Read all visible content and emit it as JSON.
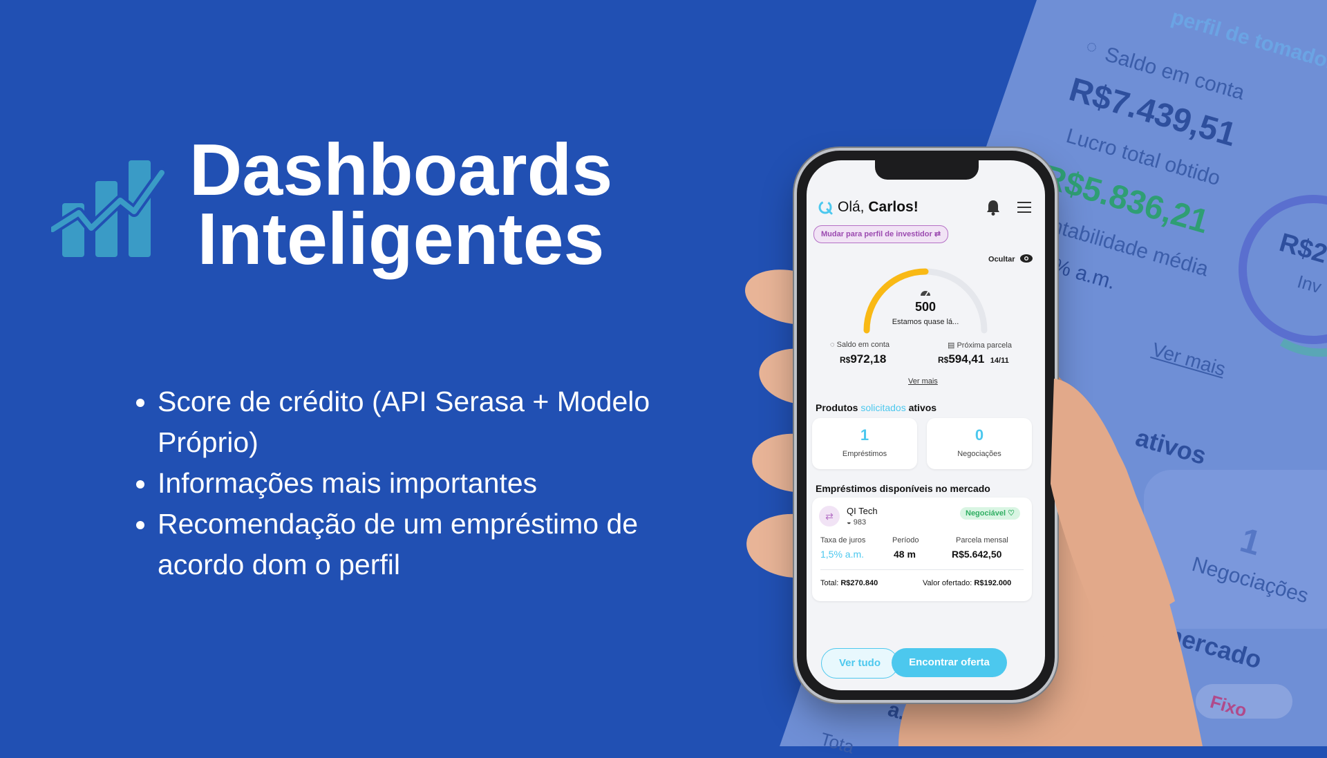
{
  "hero": {
    "title_line1": "Dashboards",
    "title_line2": "Inteligentes",
    "bullets": [
      "Score de crédito (API Serasa + Modelo Próprio)",
      "Informações mais importantes",
      "Recomendação de um empréstimo de acordo dom o perfil"
    ]
  },
  "background_panel": {
    "profile_link": "perfil de tomador",
    "saldo_label": "Saldo em conta",
    "saldo_value": "R$7.439,51",
    "lucro_label": "Lucro total obtido",
    "lucro_value": "R$5.836,21",
    "rentabilidade_label": "ntabilidade média",
    "rentabilidade_value": "% a.m.",
    "donut_value": "R$2",
    "donut_label": "Inv",
    "ver_mais": "Ver mais",
    "ativos": "ativos",
    "negociacoes_count": "1",
    "negociacoes_label": "Negociações",
    "mercado": "no mercado",
    "fixo_badge": "Fixo",
    "partial_amount": "a.m",
    "partial_total": "Tota"
  },
  "app": {
    "greeting_prefix": "Olá, ",
    "user_name": "Carlos!",
    "switch_profile": "Mudar para perfil de investidor",
    "hide_label": "Ocultar",
    "score": {
      "value": "500",
      "message": "Estamos quase lá...",
      "fill_fraction": 0.5
    },
    "saldo": {
      "label": "Saldo em conta",
      "currency": "R$",
      "value": "972,18"
    },
    "parcela": {
      "label": "Próxima parcela",
      "currency": "R$",
      "value": "594,41",
      "date": "14/11"
    },
    "ver_mais": "Ver mais",
    "produtos": {
      "title_a": "Produtos ",
      "title_b": "solicitados",
      "title_c": " ativos",
      "emprestimos_count": "1",
      "emprestimos_label": "Empréstimos",
      "negociacoes_count": "0",
      "negociacoes_label": "Negociações"
    },
    "mercado": {
      "title": "Empréstimos disponíveis no mercado",
      "lender": "QI Tech",
      "lender_score": "983",
      "badge": "Negociável",
      "taxa_label": "Taxa de juros",
      "taxa_value": "1,5% a.m.",
      "periodo_label": "Período",
      "periodo_value": "48 m",
      "parcela_label": "Parcela mensal",
      "parcela_value": "R$5.642,50",
      "total_label": "Total: ",
      "total_value": "R$270.840",
      "ofertado_label": "Valor ofertado: ",
      "ofertado_value": "R$192.000"
    },
    "buttons": {
      "ver_tudo": "Ver tudo",
      "encontrar": "Encontrar oferta"
    }
  },
  "colors": {
    "background": "#2150b3",
    "accent_cyan": "#4cc8ee",
    "gauge_yellow": "#f9b915",
    "badge_green": "#2fae62",
    "logo_teal": "#3a9bc6"
  }
}
